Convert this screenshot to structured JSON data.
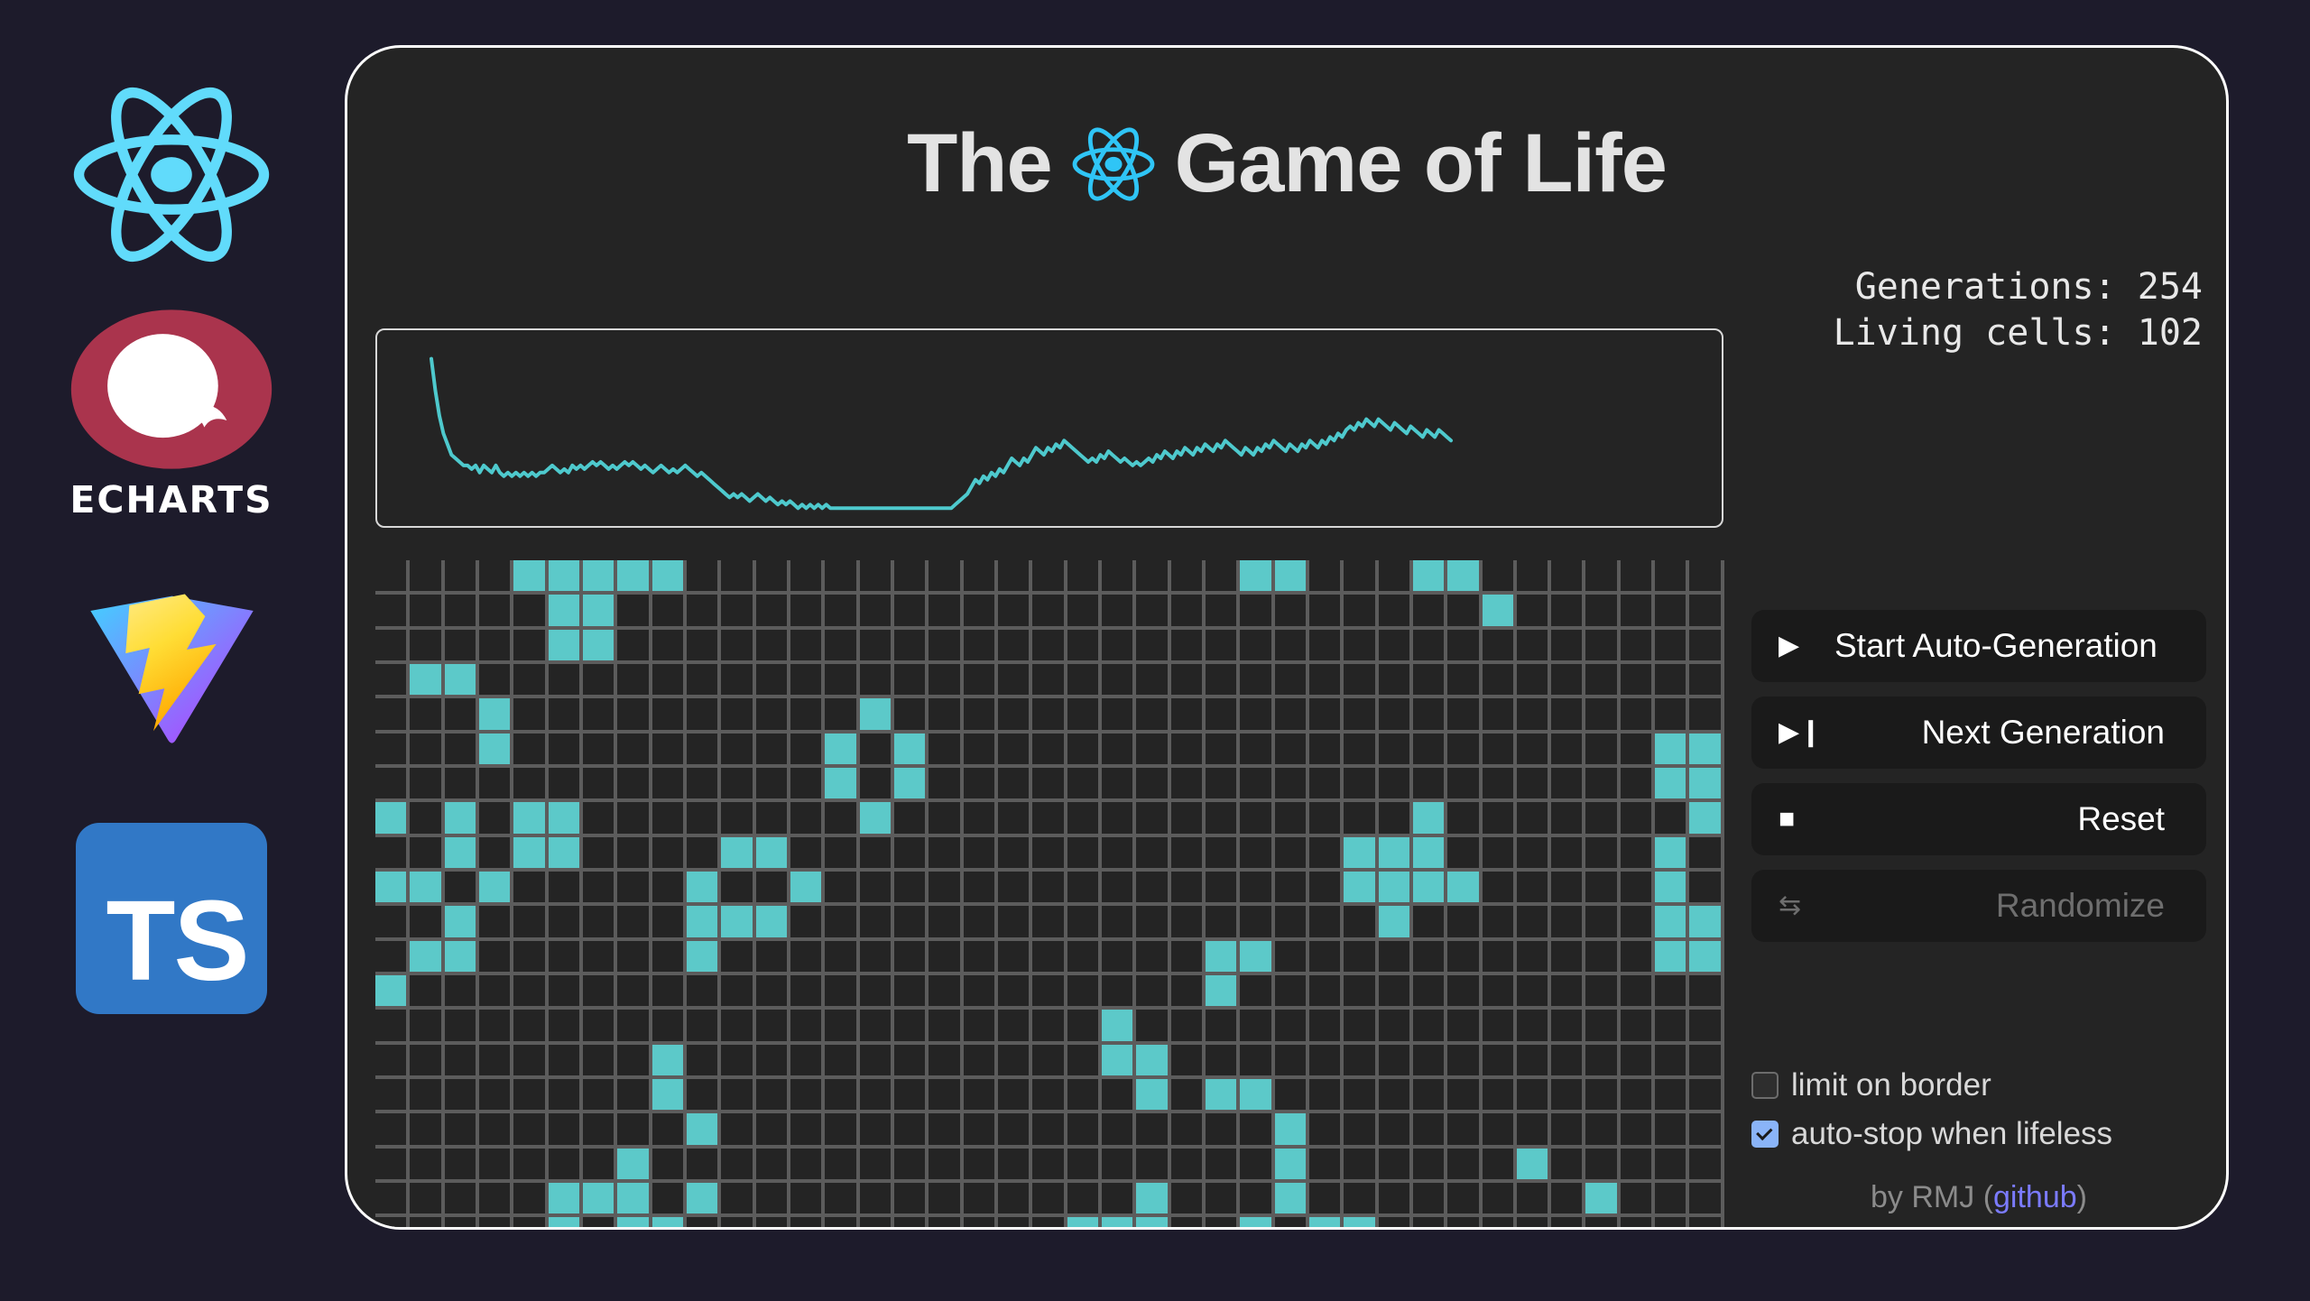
{
  "app": {
    "title_pre": "The",
    "title_post": "Game of Life",
    "bg_color": "#1d1b2b",
    "card_color": "#242424",
    "accent_cell": "#5cc9c9",
    "accent_line": "#4ec9cd"
  },
  "sidebar": {
    "logos": [
      {
        "name": "react-logo",
        "label": ""
      },
      {
        "name": "echarts-logo",
        "label": "ECHARTS"
      },
      {
        "name": "vite-logo",
        "label": ""
      },
      {
        "name": "typescript-logo",
        "label": "TS"
      }
    ]
  },
  "stats": {
    "generations_line": "Generations: 254",
    "living_line": "Living cells: 102",
    "generations": 254,
    "living_cells": 102
  },
  "buttons": [
    {
      "id": "start",
      "glyph": "▶",
      "icon": "play-icon",
      "label": "Start Auto-Generation",
      "disabled": false
    },
    {
      "id": "next",
      "glyph": "▶❙",
      "icon": "play-pause-icon",
      "label": "Next Generation",
      "disabled": false
    },
    {
      "id": "reset",
      "glyph": "■",
      "icon": "stop-icon",
      "label": "Reset",
      "disabled": false
    },
    {
      "id": "randomize",
      "glyph": "⇆",
      "icon": "shuffle-icon",
      "label": "Randomize",
      "disabled": true
    }
  ],
  "checkboxes": [
    {
      "id": "limit-on-border",
      "label": "limit on border",
      "checked": false
    },
    {
      "id": "auto-stop-when-lifeless",
      "label": "auto-stop when lifeless",
      "checked": true
    }
  ],
  "credit": {
    "prefix": "by RMJ (",
    "link": "github",
    "suffix": ")"
  },
  "chart_data": {
    "type": "line",
    "title": "",
    "xlabel": "",
    "ylabel": "",
    "series": [
      {
        "name": "living cells",
        "color": "#4ec9cd",
        "values": [
          142,
          133,
          126,
          121,
          118,
          115,
          114,
          113,
          112,
          112,
          111,
          112,
          110,
          112,
          111,
          110,
          112,
          110,
          109,
          110,
          109,
          110,
          109,
          110,
          109,
          110,
          109,
          110,
          110,
          111,
          112,
          111,
          110,
          111,
          110,
          112,
          111,
          112,
          111,
          112,
          113,
          112,
          113,
          112,
          111,
          112,
          111,
          112,
          113,
          112,
          113,
          112,
          111,
          112,
          111,
          110,
          111,
          112,
          111,
          110,
          111,
          110,
          111,
          112,
          111,
          110,
          109,
          110,
          109,
          108,
          107,
          106,
          105,
          104,
          103,
          104,
          103,
          104,
          103,
          102,
          103,
          104,
          103,
          102,
          103,
          102,
          101,
          102,
          101,
          102,
          101,
          100,
          101,
          100,
          101,
          100,
          101,
          100,
          101,
          100,
          100,
          100,
          100,
          100,
          100,
          100,
          100,
          100,
          100,
          100,
          100,
          100,
          100,
          100,
          100,
          100,
          100,
          100,
          100,
          100,
          100,
          100,
          100,
          100,
          100,
          100,
          100,
          100,
          100,
          100,
          101,
          102,
          103,
          104,
          106,
          108,
          107,
          109,
          108,
          110,
          109,
          111,
          110,
          112,
          114,
          113,
          112,
          114,
          113,
          115,
          117,
          116,
          115,
          117,
          116,
          118,
          117,
          119,
          118,
          117,
          116,
          115,
          114,
          113,
          114,
          113,
          115,
          114,
          116,
          115,
          114,
          113,
          114,
          113,
          112,
          113,
          112,
          113,
          114,
          113,
          115,
          114,
          116,
          115,
          114,
          116,
          115,
          117,
          116,
          115,
          117,
          116,
          118,
          117,
          116,
          118,
          117,
          119,
          118,
          117,
          116,
          115,
          117,
          116,
          115,
          117,
          116,
          118,
          117,
          119,
          118,
          117,
          116,
          118,
          117,
          116,
          118,
          117,
          119,
          118,
          117,
          119,
          118,
          120,
          119,
          121,
          120,
          122,
          123,
          122,
          124,
          123,
          125,
          124,
          123,
          125,
          124,
          123,
          122,
          124,
          123,
          122,
          121,
          123,
          122,
          121,
          120,
          122,
          121,
          120,
          122,
          121,
          120,
          119
        ]
      }
    ],
    "ylim": [
      95,
      150
    ],
    "grid": false,
    "legend": "none"
  },
  "board": {
    "columns": 39,
    "rows": 20,
    "alive": [
      [
        0,
        4
      ],
      [
        0,
        5
      ],
      [
        0,
        6
      ],
      [
        0,
        7
      ],
      [
        0,
        8
      ],
      [
        0,
        25
      ],
      [
        0,
        26
      ],
      [
        0,
        30
      ],
      [
        0,
        31
      ],
      [
        1,
        5
      ],
      [
        1,
        6
      ],
      [
        1,
        32
      ],
      [
        2,
        5
      ],
      [
        2,
        6
      ],
      [
        3,
        1
      ],
      [
        3,
        2
      ],
      [
        4,
        3
      ],
      [
        4,
        14
      ],
      [
        5,
        3
      ],
      [
        5,
        13
      ],
      [
        5,
        15
      ],
      [
        5,
        37
      ],
      [
        5,
        38
      ],
      [
        6,
        13
      ],
      [
        6,
        15
      ],
      [
        6,
        37
      ],
      [
        6,
        38
      ],
      [
        7,
        0
      ],
      [
        7,
        2
      ],
      [
        7,
        4
      ],
      [
        7,
        5
      ],
      [
        7,
        14
      ],
      [
        7,
        38
      ],
      [
        7,
        30
      ],
      [
        8,
        2
      ],
      [
        8,
        4
      ],
      [
        8,
        5
      ],
      [
        8,
        10
      ],
      [
        8,
        11
      ],
      [
        8,
        37
      ],
      [
        8,
        28
      ],
      [
        8,
        29
      ],
      [
        8,
        30
      ],
      [
        9,
        0
      ],
      [
        9,
        1
      ],
      [
        9,
        3
      ],
      [
        9,
        9
      ],
      [
        9,
        12
      ],
      [
        9,
        37
      ],
      [
        9,
        28
      ],
      [
        9,
        29
      ],
      [
        9,
        30
      ],
      [
        9,
        31
      ],
      [
        10,
        2
      ],
      [
        10,
        9
      ],
      [
        10,
        10
      ],
      [
        10,
        11
      ],
      [
        10,
        37
      ],
      [
        10,
        29
      ],
      [
        10,
        38
      ],
      [
        11,
        1
      ],
      [
        11,
        2
      ],
      [
        11,
        9
      ],
      [
        11,
        24
      ],
      [
        11,
        25
      ],
      [
        11,
        37
      ],
      [
        11,
        38
      ],
      [
        12,
        0
      ],
      [
        12,
        24
      ],
      [
        13,
        21
      ],
      [
        14,
        8
      ],
      [
        14,
        21
      ],
      [
        14,
        22
      ],
      [
        15,
        8
      ],
      [
        15,
        22
      ],
      [
        15,
        24
      ],
      [
        15,
        25
      ],
      [
        16,
        9
      ],
      [
        16,
        26
      ],
      [
        17,
        7
      ],
      [
        17,
        26
      ],
      [
        17,
        33
      ],
      [
        18,
        5
      ],
      [
        18,
        6
      ],
      [
        18,
        7
      ],
      [
        18,
        9
      ],
      [
        18,
        22
      ],
      [
        18,
        26
      ],
      [
        18,
        35
      ],
      [
        19,
        5
      ],
      [
        19,
        7
      ],
      [
        19,
        8
      ],
      [
        19,
        20
      ],
      [
        19,
        21
      ],
      [
        19,
        22
      ],
      [
        19,
        25
      ],
      [
        19,
        27
      ],
      [
        19,
        28
      ]
    ]
  }
}
